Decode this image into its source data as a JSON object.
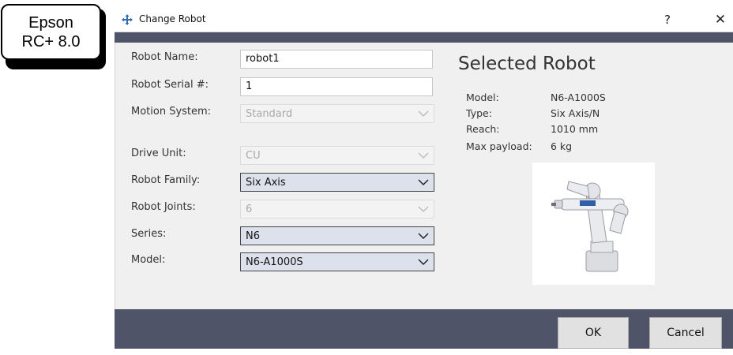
{
  "badge": {
    "line1": "Epson",
    "line2": "RC+ 8.0"
  },
  "window": {
    "title": "Change Robot",
    "help": "?",
    "close": "✕"
  },
  "form": {
    "robot_name_label": "Robot Name:",
    "robot_name_value": "robot1",
    "robot_serial_label": "Robot Serial #:",
    "robot_serial_value": "1",
    "motion_system_label": "Motion System:",
    "motion_system_value": "Standard",
    "drive_unit_label": "Drive Unit:",
    "drive_unit_value": "CU",
    "robot_family_label": "Robot Family:",
    "robot_family_value": "Six Axis",
    "robot_joints_label": "Robot Joints:",
    "robot_joints_value": "6",
    "series_label": "Series:",
    "series_value": "N6",
    "model_label": "Model:",
    "model_value": "N6-A1000S"
  },
  "selected": {
    "heading": "Selected Robot",
    "model_key": "Model:",
    "model_val": "N6-A1000S",
    "type_key": "Type:",
    "type_val": "Six Axis/N",
    "reach_key": "Reach:",
    "reach_val": "1010  mm",
    "payload_key": "Max payload:",
    "payload_val": "6  kg"
  },
  "buttons": {
    "ok": "OK",
    "cancel": "Cancel"
  },
  "icons": {
    "title": "move-arrows-icon",
    "chevron": "chevron-down-icon",
    "robot": "robot-arm-image"
  },
  "colors": {
    "bar": "#4f5468",
    "combo_bg": "#dde1ec",
    "panel": "#f0f0f0"
  }
}
